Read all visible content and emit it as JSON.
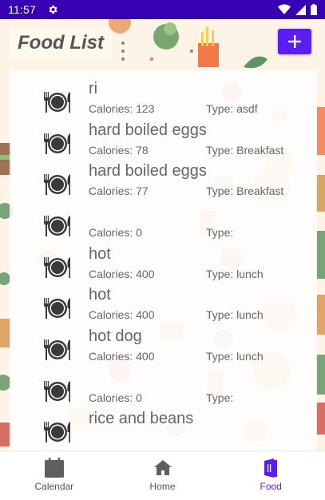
{
  "status_bar": {
    "time": "11:57"
  },
  "header": {
    "title": "Food List"
  },
  "food_items": [
    {
      "name": "ri",
      "calories_label": "Calories: 123",
      "type_label": "Type: asdf"
    },
    {
      "name": "hard boiled eggs",
      "calories_label": "Calories: 78",
      "type_label": "Type: Breakfast"
    },
    {
      "name": "hard boiled eggs",
      "calories_label": "Calories: 77",
      "type_label": "Type: Breakfast"
    },
    {
      "name": "",
      "calories_label": "Calories: 0",
      "type_label": "Type:"
    },
    {
      "name": "hot",
      "calories_label": "Calories: 400",
      "type_label": "Type: lunch"
    },
    {
      "name": "hot",
      "calories_label": "Calories: 400",
      "type_label": "Type: lunch"
    },
    {
      "name": "hot dog",
      "calories_label": "Calories: 400",
      "type_label": "Type: lunch"
    },
    {
      "name": "",
      "calories_label": "Calories: 0",
      "type_label": "Type:"
    },
    {
      "name": "rice and beans",
      "calories_label": "",
      "type_label": ""
    }
  ],
  "bottom_nav": {
    "items": [
      {
        "label": "Calendar",
        "icon": "calendar-icon"
      },
      {
        "label": "Home",
        "icon": "home-icon"
      },
      {
        "label": "Food",
        "icon": "food-menu-icon"
      }
    ],
    "active": "Food"
  },
  "colors": {
    "status_bar": "#3700b3",
    "accent": "#5b1ef2",
    "background": "#fdf3e6",
    "text": "#666666"
  }
}
